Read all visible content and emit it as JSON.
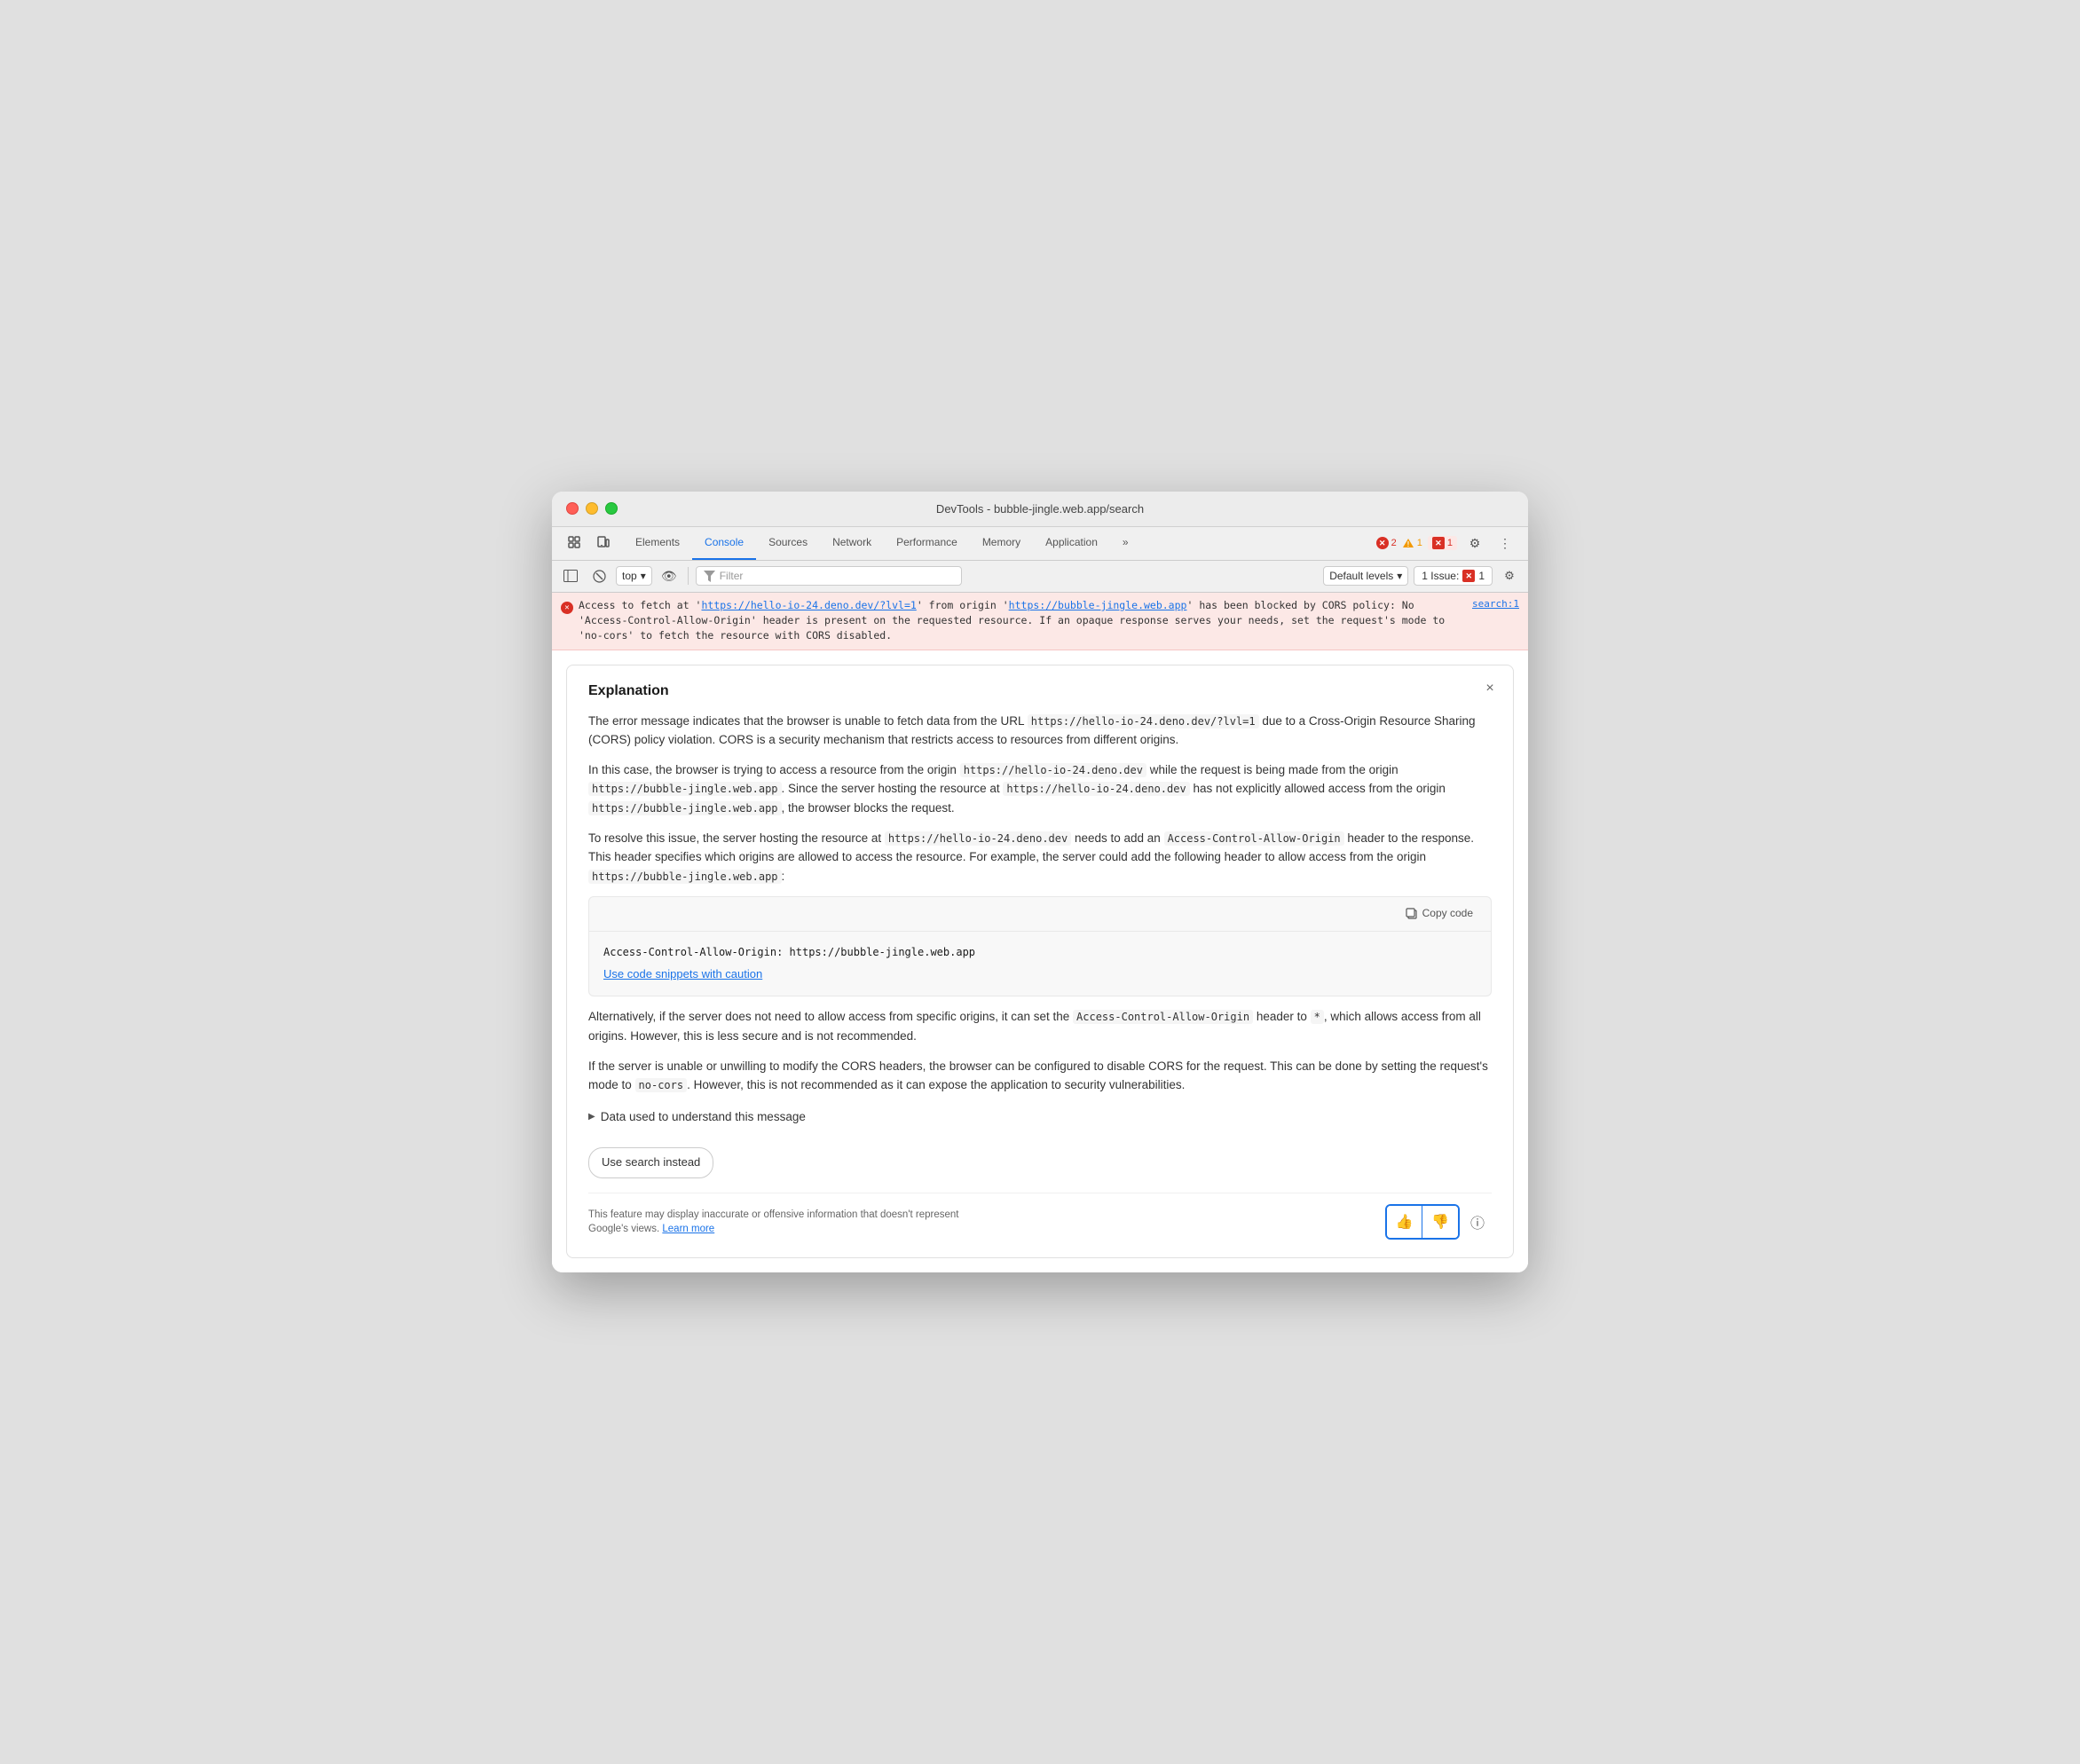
{
  "window": {
    "title": "DevTools - bubble-jingle.web.app/search"
  },
  "tabs": {
    "items": [
      {
        "label": "Elements",
        "active": false
      },
      {
        "label": "Console",
        "active": true
      },
      {
        "label": "Sources",
        "active": false
      },
      {
        "label": "Network",
        "active": false
      },
      {
        "label": "Performance",
        "active": false
      },
      {
        "label": "Memory",
        "active": false
      },
      {
        "label": "Application",
        "active": false
      }
    ],
    "more_label": "»",
    "error_count": "2",
    "warn_count": "1",
    "info_count": "1"
  },
  "toolbar": {
    "top_label": "top",
    "filter_placeholder": "Filter",
    "filter_icon": "⊟",
    "default_levels_label": "Default levels",
    "issue_label": "1 Issue:",
    "issue_count": "1"
  },
  "error_row": {
    "text_before": "Access to fetch at '",
    "url1": "https://hello-io-24.deno.dev/?lvl=1",
    "text_middle": "' from origin '",
    "url2": "https://bubble-jingle.web.app",
    "text_after": "' has been blocked by CORS policy: No 'Access-Control-Allow-Origin' header is present on the requested resource. If an opaque response serves your needs, set the request's mode to 'no-cors' to fetch the resource with CORS disabled.",
    "source": "search:1"
  },
  "explanation": {
    "title": "Explanation",
    "close_label": "×",
    "paragraphs": [
      "The error message indicates that the browser is unable to fetch data from the URL https://hello-io-24.deno.dev/?lvl=1 due to a Cross-Origin Resource Sharing (CORS) policy violation. CORS is a security mechanism that restricts access to resources from different origins.",
      "In this case, the browser is trying to access a resource from the origin https://hello-io-24.deno.dev while the request is being made from the origin https://bubble-jingle.web.app. Since the server hosting the resource at https://hello-io-24.deno.dev has not explicitly allowed access from the origin https://bubble-jingle.web.app, the browser blocks the request.",
      "To resolve this issue, the server hosting the resource at https://hello-io-24.deno.dev needs to add an Access-Control-Allow-Origin header to the response. This header specifies which origins are allowed to access the resource. For example, the server could add the following header to allow access from the origin https://bubble-jingle.web.app:"
    ],
    "code_snippet": "Access-Control-Allow-Origin: https://bubble-jingle.web.app",
    "copy_code_label": "Copy code",
    "caution_label": "Use code snippets with caution",
    "paragraphs2": [
      "Alternatively, if the server does not need to allow access from specific origins, it can set the Access-Control-Allow-Origin header to *, which allows access from all origins. However, this is less secure and is not recommended.",
      "If the server is unable or unwilling to modify the CORS headers, the browser can be configured to disable CORS for the request. This can be done by setting the request's mode to no-cors. However, this is not recommended as it can expose the application to security vulnerabilities."
    ],
    "data_section_label": "Data used to understand this message",
    "use_search_label": "Use search instead",
    "footer_disclaimer": "This feature may display inaccurate or offensive information that doesn't represent Google's views.",
    "learn_more_label": "Learn more",
    "thumbs_up_label": "👍",
    "thumbs_down_label": "👎",
    "info_label": "ⓘ"
  }
}
